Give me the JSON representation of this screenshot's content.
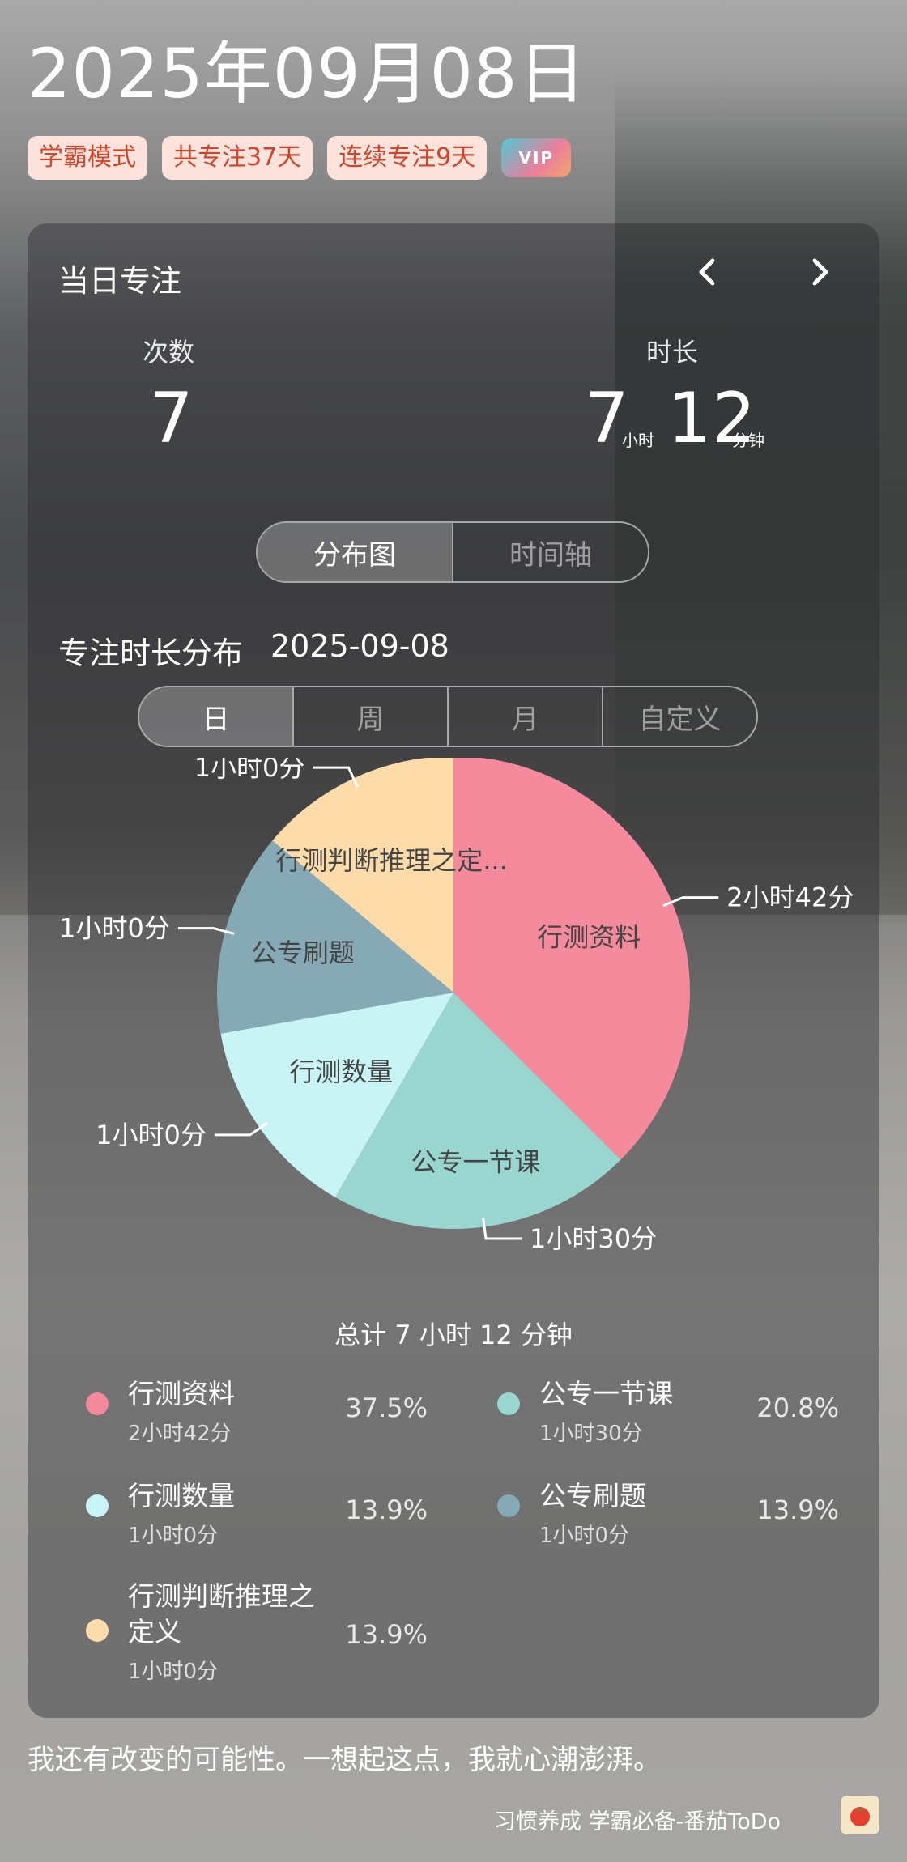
{
  "header": {
    "date_title": "2025年09月08日",
    "badges": [
      "学霸模式",
      "共专注37天",
      "连续专注9天"
    ],
    "vip_label": "VIP"
  },
  "daily": {
    "title": "当日专注",
    "count_label": "次数",
    "count_value": "7",
    "duration_label": "时长",
    "hours_value": "7",
    "hours_unit": "小时",
    "minutes_value": "12",
    "minutes_unit": "分钟"
  },
  "view_tabs": [
    {
      "label": "分布图",
      "active": true
    },
    {
      "label": "时间轴",
      "active": false
    }
  ],
  "distribution": {
    "title": "专注时长分布",
    "date": "2025-09-08",
    "range_tabs": [
      {
        "label": "日",
        "active": true
      },
      {
        "label": "周",
        "active": false
      },
      {
        "label": "月",
        "active": false
      },
      {
        "label": "自定义",
        "active": false
      }
    ],
    "total_text": "总计 7 小时 12 分钟"
  },
  "chart_data": {
    "type": "pie",
    "slices": [
      {
        "name": "行测资料",
        "label": "行测资料",
        "value": 162,
        "duration": "2小时42分",
        "percent": "37.5%",
        "color": "#f48a9b"
      },
      {
        "name": "公专一节课",
        "label": "公专一节课",
        "value": 90,
        "duration": "1小时30分",
        "percent": "20.8%",
        "color": "#98d6cf"
      },
      {
        "name": "行测数量",
        "label": "行测数量",
        "value": 60,
        "duration": "1小时0分",
        "percent": "13.9%",
        "color": "#c8f4f6"
      },
      {
        "name": "公专刷题",
        "label": "公专刷题",
        "value": 60,
        "duration": "1小时0分",
        "percent": "13.9%",
        "color": "#86aab5"
      },
      {
        "name": "行测判断推理之定义",
        "label": "行测判断推理之定...",
        "value": 60,
        "duration": "1小时0分",
        "percent": "13.9%",
        "color": "#fddca9"
      }
    ]
  },
  "quote": "我还有改变的可能性。一想起这点，我就心潮澎湃。",
  "footer": {
    "text": "习惯养成 学霸必备-番茄ToDo",
    "icon": "tomato-icon"
  }
}
